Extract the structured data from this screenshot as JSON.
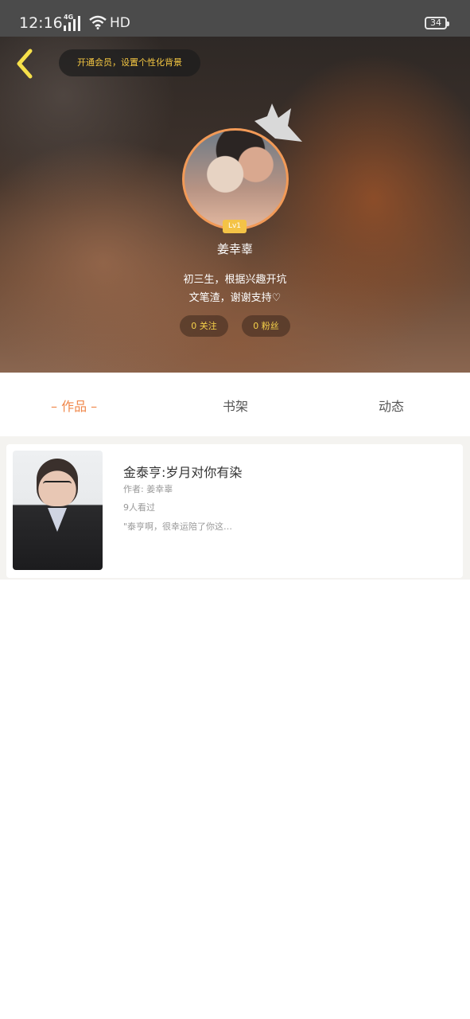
{
  "status_bar": {
    "time": "12:16",
    "network": "4G",
    "hd": "HD",
    "battery": "34"
  },
  "header": {
    "vip_prompt": "开通会员，设置个性化背景"
  },
  "profile": {
    "level": "Lv1",
    "name": "姜幸辜",
    "bio_line1": "初三生，根据兴趣开坑",
    "bio_line2": "文笔渣，谢谢支持♡",
    "follow": "0 关注",
    "fans": "0 粉丝"
  },
  "tabs": [
    {
      "label": "– 作品 –",
      "active": true
    },
    {
      "label": "书架",
      "active": false
    },
    {
      "label": "动态",
      "active": false
    }
  ],
  "works": [
    {
      "title": "金泰亨:岁月对你有染",
      "author": "作者: 姜幸辜",
      "views": "9人看过",
      "excerpt": "\"泰亨啊，很幸运陪了你这…"
    }
  ],
  "colors": {
    "accent": "#f0874a",
    "vip_text": "#f6c842",
    "level_badge": "#f4c346"
  }
}
